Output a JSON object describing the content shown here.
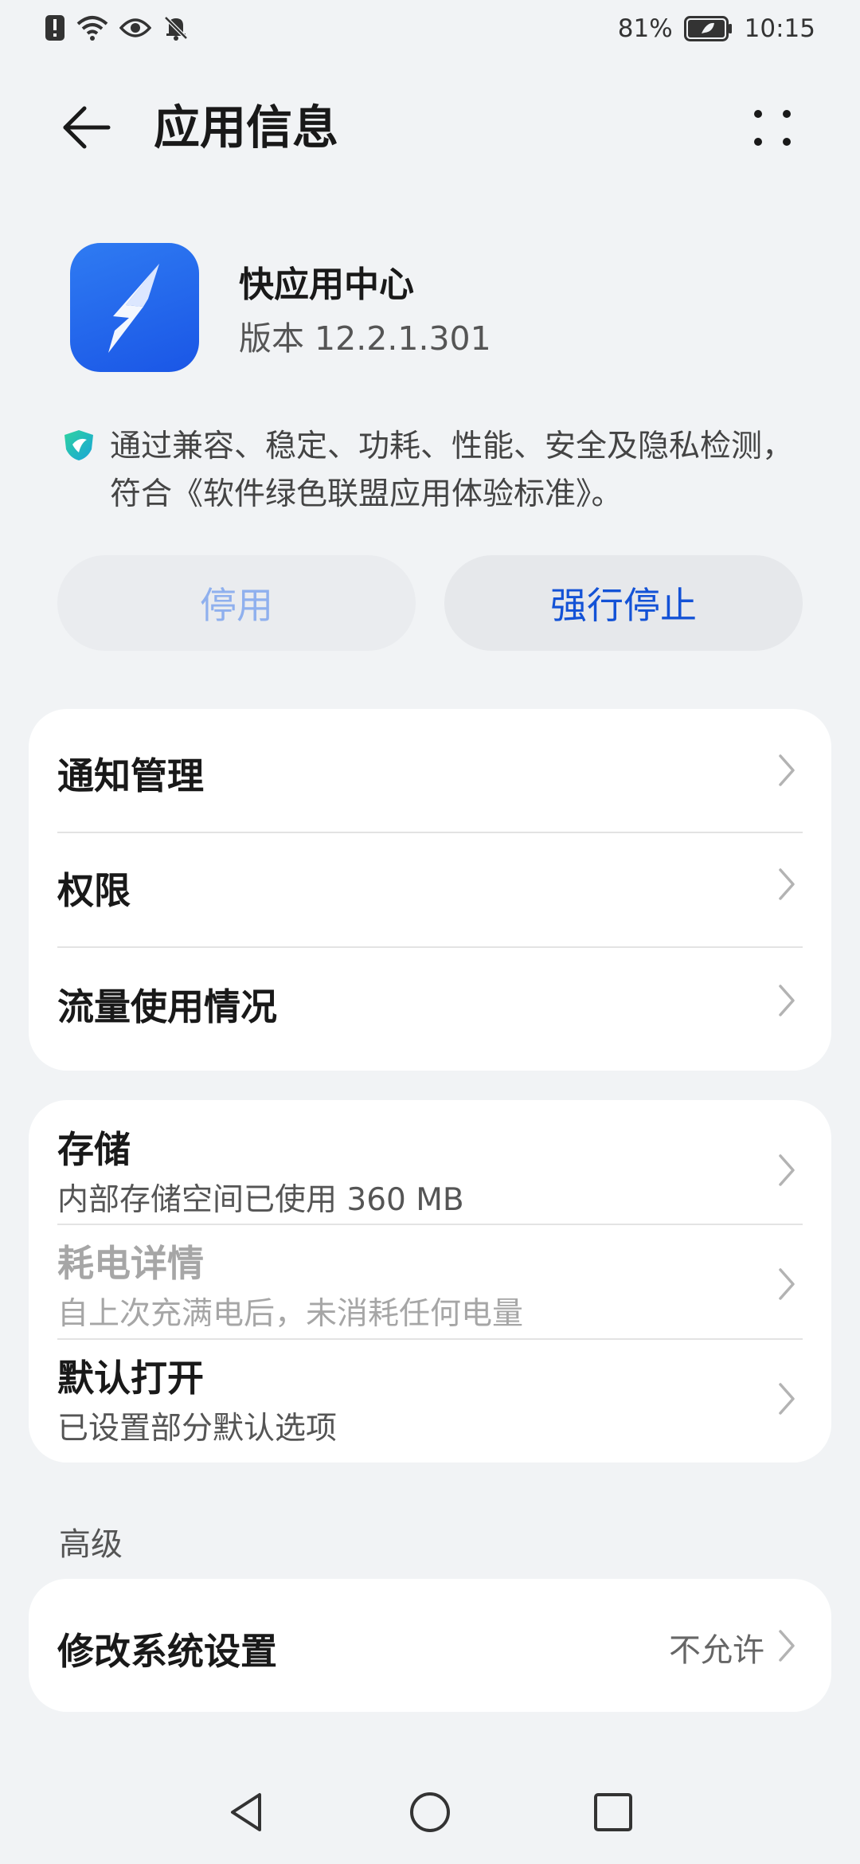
{
  "status_bar": {
    "battery_percent": "81%",
    "time": "10:15",
    "icons": [
      "alert-icon",
      "wifi-icon",
      "eye-icon",
      "bell-off-icon",
      "battery-icon"
    ]
  },
  "header": {
    "title": "应用信息"
  },
  "app": {
    "name": "快应用中心",
    "version": "版本 12.2.1.301",
    "icon_color": "#1f62ec"
  },
  "certification": {
    "text": "通过兼容、稳定、功耗、性能、安全及隐私检测，符合《软件绿色联盟应用体验标准》。"
  },
  "actions": {
    "disable_label": "停用",
    "force_stop_label": "强行停止",
    "accent_color": "#1352d6"
  },
  "group1": [
    {
      "title": "通知管理"
    },
    {
      "title": "权限"
    },
    {
      "title": "流量使用情况"
    }
  ],
  "group2": [
    {
      "title": "存储",
      "subtitle": "内部存储空间已使用 360 MB"
    },
    {
      "title": "耗电详情",
      "subtitle": "自上次充满电后，未消耗任何电量"
    },
    {
      "title": "默认打开",
      "subtitle": "已设置部分默认选项"
    }
  ],
  "advanced": {
    "label": "高级",
    "items": [
      {
        "title": "修改系统设置",
        "value": "不允许"
      }
    ]
  }
}
